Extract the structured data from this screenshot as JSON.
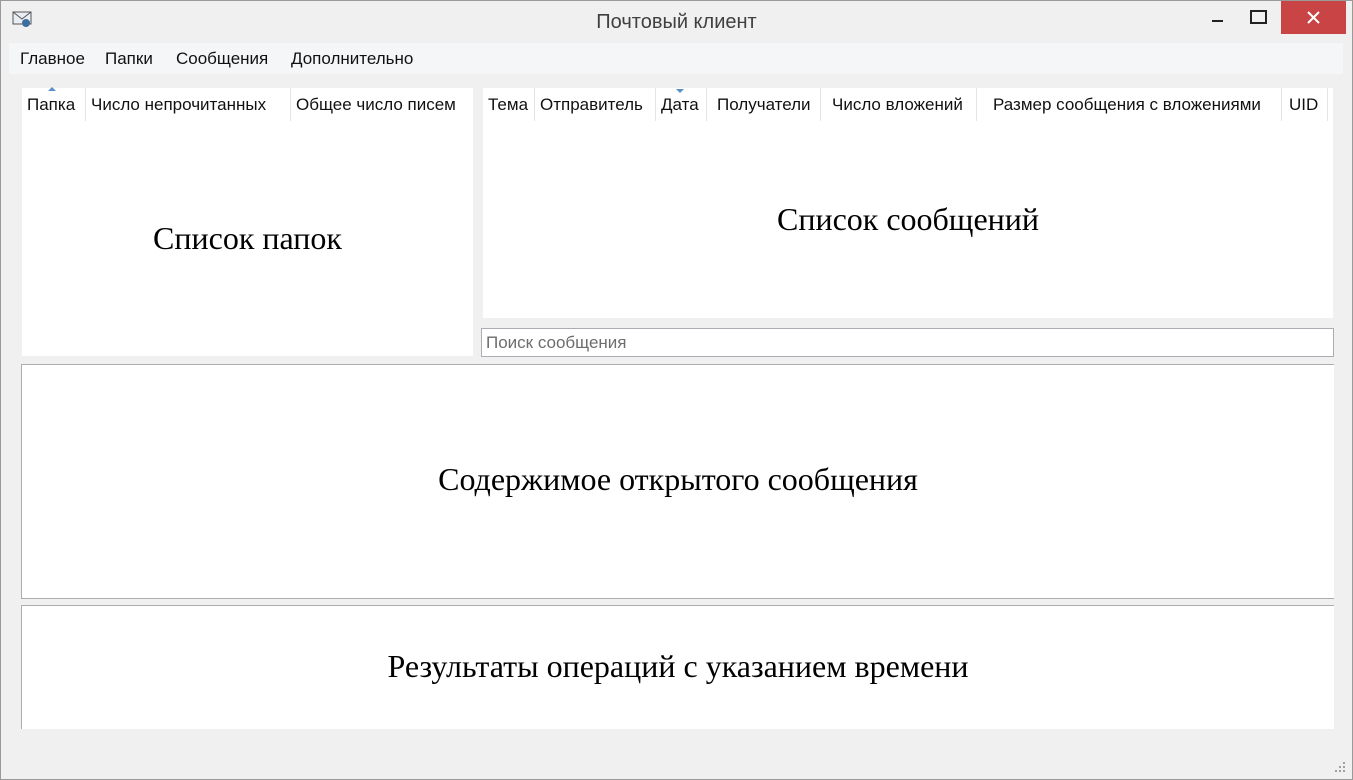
{
  "window": {
    "title": "Почтовый клиент",
    "icon": "mail-envelope-icon",
    "controls": [
      "minimize-icon",
      "maximize-icon",
      "close-icon"
    ],
    "close_color": "#c94545"
  },
  "menu": {
    "items": [
      {
        "label": "Главное"
      },
      {
        "label": "Папки"
      },
      {
        "label": "Сообщения"
      },
      {
        "label": "Дополнительно"
      }
    ]
  },
  "folders": {
    "columns": [
      {
        "label": "Папка"
      },
      {
        "label": "Число непрочитанных"
      },
      {
        "label": "Общее число писем"
      }
    ],
    "sort_column": "Папка",
    "sort_direction": "ascending",
    "placeholder_label": "Список папок"
  },
  "messages": {
    "columns": [
      {
        "label": "Тема"
      },
      {
        "label": "Отправитель"
      },
      {
        "label": "Дата"
      },
      {
        "label": "Получатели"
      },
      {
        "label": "Число вложений"
      },
      {
        "label": "Размер сообщения с вложениями"
      },
      {
        "label": "UID"
      }
    ],
    "sort_column": "Дата",
    "sort_direction": "descending",
    "placeholder_label": "Список сообщений"
  },
  "search": {
    "placeholder": "Поиск сообщения",
    "value": ""
  },
  "message_view": {
    "placeholder_label": "Содержимое открытого сообщения"
  },
  "log": {
    "placeholder_label": "Результаты операций с указанием времени"
  },
  "colors": {
    "background": "#f0f0f0",
    "panel": "#ffffff",
    "sort_arrow": "#5a8fc7"
  }
}
